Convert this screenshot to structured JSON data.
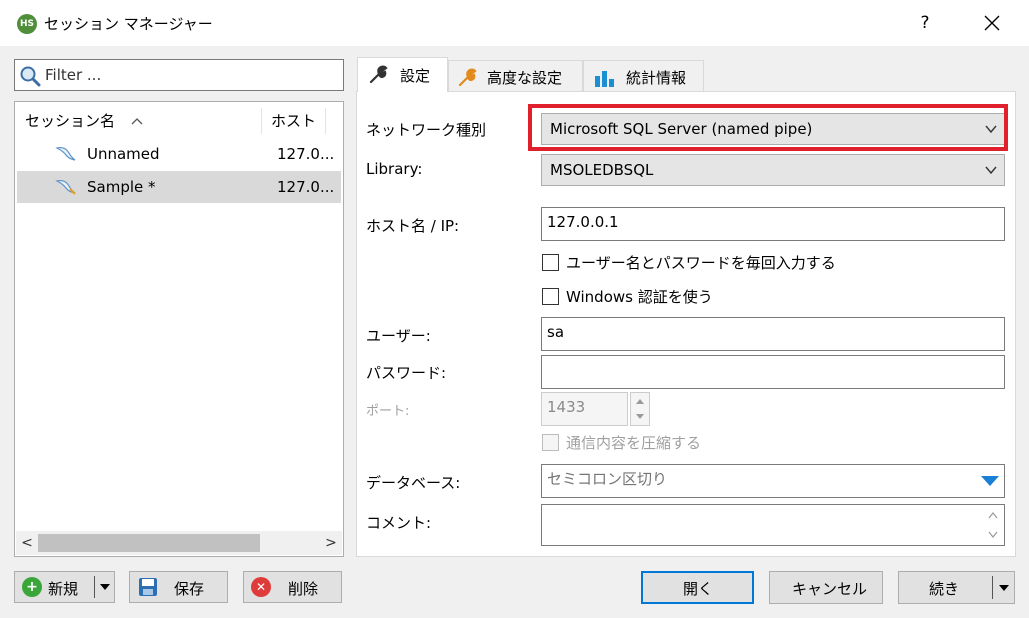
{
  "window": {
    "icon_text": "HS",
    "title": "セッション マネージャー",
    "help": "?"
  },
  "left": {
    "filter_placeholder": "Filter ...",
    "columns": [
      "セッション名",
      "ホスト"
    ],
    "sort_indicator": "^",
    "sessions": [
      {
        "name": "Unnamed",
        "host": "127.0..."
      },
      {
        "name": "Sample *",
        "host": "127.0..."
      }
    ],
    "scroll_left": "<",
    "scroll_right": ">"
  },
  "bottom_left": {
    "new_label": "新規",
    "save_label": "保存",
    "delete_label": "削除"
  },
  "tabs": [
    {
      "label": "設定",
      "icon": "wrench-icon"
    },
    {
      "label": "高度な設定",
      "icon": "wrench-orange-icon"
    },
    {
      "label": "統計情報",
      "icon": "bar-chart-icon"
    }
  ],
  "settings": {
    "network_type_label": "ネットワーク種別",
    "network_type_value": "Microsoft SQL Server (named pipe)",
    "library_label": "Library:",
    "library_value": "MSOLEDBSQL",
    "host_label": "ホスト名 / IP:",
    "host_value": "127.0.0.1",
    "prompt_label": "ユーザー名とパスワードを毎回入力する",
    "windows_auth_label": "Windows 認証を使う",
    "user_label": "ユーザー:",
    "user_value": "sa",
    "password_label": "パスワード:",
    "password_value": "",
    "port_label": "ポート:",
    "port_value": "1433",
    "compress_label": "通信内容を圧縮する",
    "database_label": "データベース:",
    "database_placeholder": "セミコロン区切り",
    "comment_label": "コメント:"
  },
  "bottom_right": {
    "open_label": "開く",
    "cancel_label": "キャンセル",
    "continue_label": "続き"
  },
  "colors": {
    "highlight": "#e0202a",
    "dropdown_arrow": "#1a7fd6",
    "new_icon": "#3aa63a",
    "delete_icon": "#e03b3b"
  }
}
